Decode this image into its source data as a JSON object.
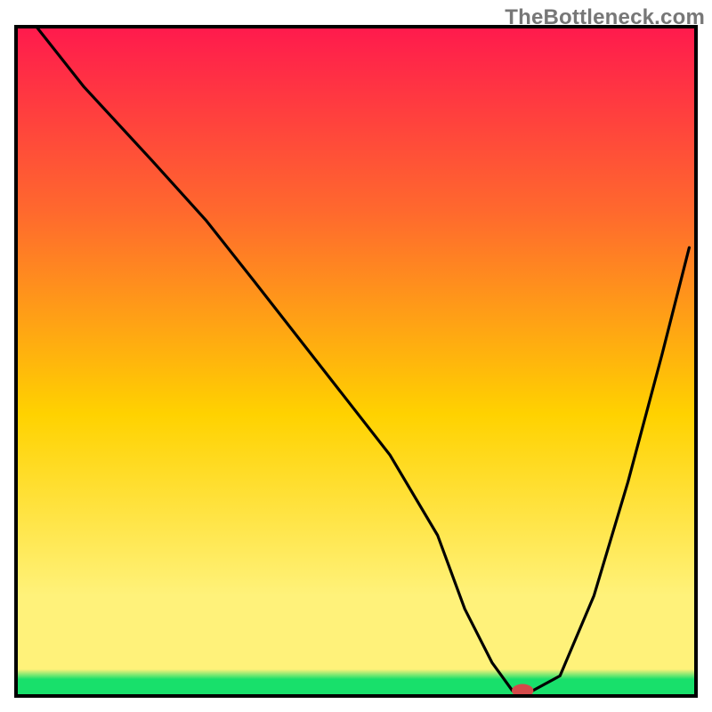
{
  "watermark": "TheBottleneck.com",
  "colors": {
    "gradient_top": "#ff1a4d",
    "gradient_mid_upper": "#ff6a2d",
    "gradient_mid": "#ffd200",
    "gradient_lower_yellow": "#fff27a",
    "gradient_green": "#18e06b",
    "curve_stroke": "#000000",
    "frame_stroke": "#000000",
    "marker_fill": "#d44a4a"
  },
  "chart_data": {
    "type": "line",
    "title": "",
    "xlabel": "",
    "ylabel": "",
    "xlim": [
      0,
      100
    ],
    "ylim": [
      0,
      100
    ],
    "grid": false,
    "legend": false,
    "note": "V-shaped bottleneck curve over red→yellow→green vertical gradient. x is normalized 0–100 horizontal position, y is normalized 0–100 measure (100 = top/red, 0 = bottom/green).",
    "series": [
      {
        "name": "bottleneck-curve",
        "x": [
          3,
          10,
          20,
          28,
          35,
          45,
          55,
          62,
          66,
          70,
          73,
          76,
          80,
          85,
          90,
          95,
          99
        ],
        "y": [
          100,
          91,
          80,
          71,
          62,
          49,
          36,
          24,
          13,
          5,
          0.8,
          0.8,
          3,
          15,
          32,
          51,
          67
        ]
      }
    ],
    "marker": {
      "name": "optimal-point",
      "x": 74.5,
      "y": 0.8,
      "rx": 1.6,
      "ry": 1.0
    }
  }
}
